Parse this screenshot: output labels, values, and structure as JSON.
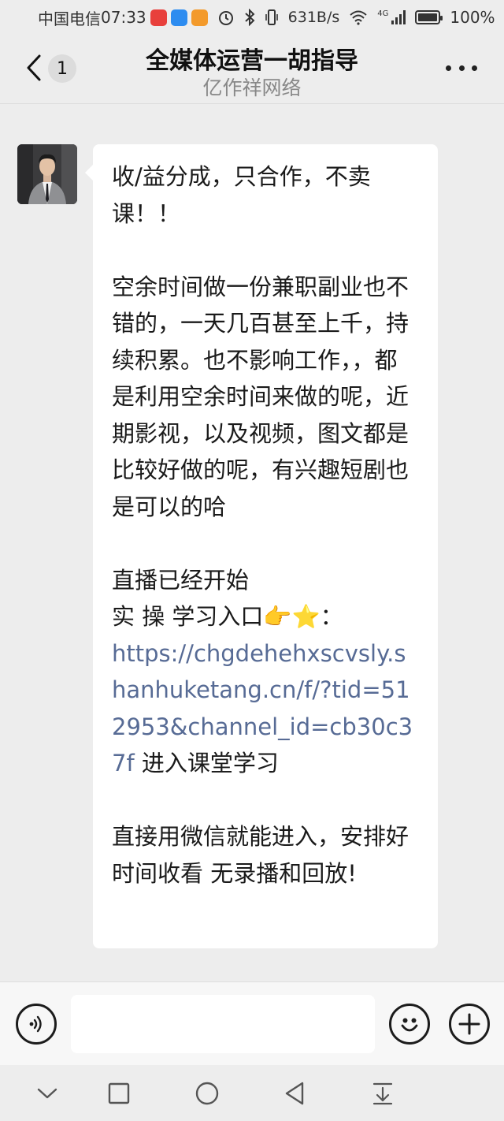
{
  "status_bar": {
    "carrier": "中国电信",
    "time": "07:33",
    "net_speed": "631B/s",
    "network_type": "4G",
    "battery": "100%",
    "app_icons": [
      "huawei-store-icon",
      "weather-icon",
      "app-notification-icon"
    ],
    "app_icon_colors": [
      "#e8403c",
      "#2d8cf0",
      "#f39a2b"
    ]
  },
  "header": {
    "title": "全媒体运营一胡指导",
    "subtitle": "亿作祥网络",
    "unread_count": "1"
  },
  "message": {
    "sender_avatar": "avatar",
    "paragraphs": [
      "收/益分成，只合作，不卖课！！",
      "空余时间做一份兼职副业也不错的，一天几百甚至上千，持续积累。也不影响工作，，都是利用空余时间来做的呢，近期影视，以及视频，图文都是比较好做的呢，有兴趣短剧也是可以的哈",
      "直播已经开始",
      "实 操 学习入口👉⭐："
    ],
    "link": "https://chgdehehxscvsly.shanhuketang.cn/f/?tid=512953&channel_id=cb30c37f",
    "link_suffix": " 进入课堂学习",
    "closing": "直接用微信就能进入，安排好时间收看 无录播和回放!"
  },
  "input_bar": {
    "text_value": "",
    "placeholder": ""
  },
  "colors": {
    "chat_background": "#ededed",
    "bubble": "#ffffff",
    "link": "#576b95"
  }
}
